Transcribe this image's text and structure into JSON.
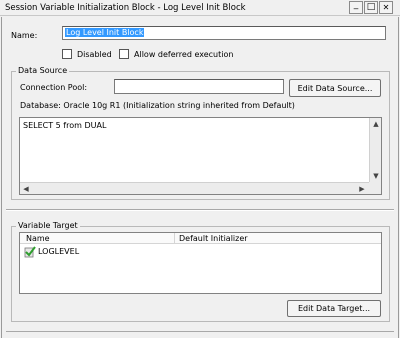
{
  "window": {
    "title": "Session Variable Initialization Block - Log Level Init Block",
    "min_glyph": "_",
    "max_glyph": "□",
    "close_glyph": "✕"
  },
  "form": {
    "name_label": "Name:",
    "name_value": "Log Level Init Block",
    "disabled_label": "Disabled",
    "deferred_label": "Allow deferred execution"
  },
  "data_source": {
    "group_title": "Data Source",
    "connection_pool_label": "Connection Pool:",
    "connection_pool_value": "",
    "edit_button": "Edit Data Source...",
    "database_info": "Database: Oracle 10g R1 (Initialization string inherited from Default)",
    "sql": "SELECT 5 from DUAL"
  },
  "variable_target": {
    "group_title": "Variable Target",
    "columns": [
      "Name",
      "Default Initializer"
    ],
    "rows": [
      {
        "name": "LOGLEVEL",
        "default": ""
      }
    ],
    "edit_button": "Edit Data Target..."
  },
  "icons": {
    "variable": "variable-check-icon"
  },
  "colors": {
    "selection": "#3399ff"
  }
}
